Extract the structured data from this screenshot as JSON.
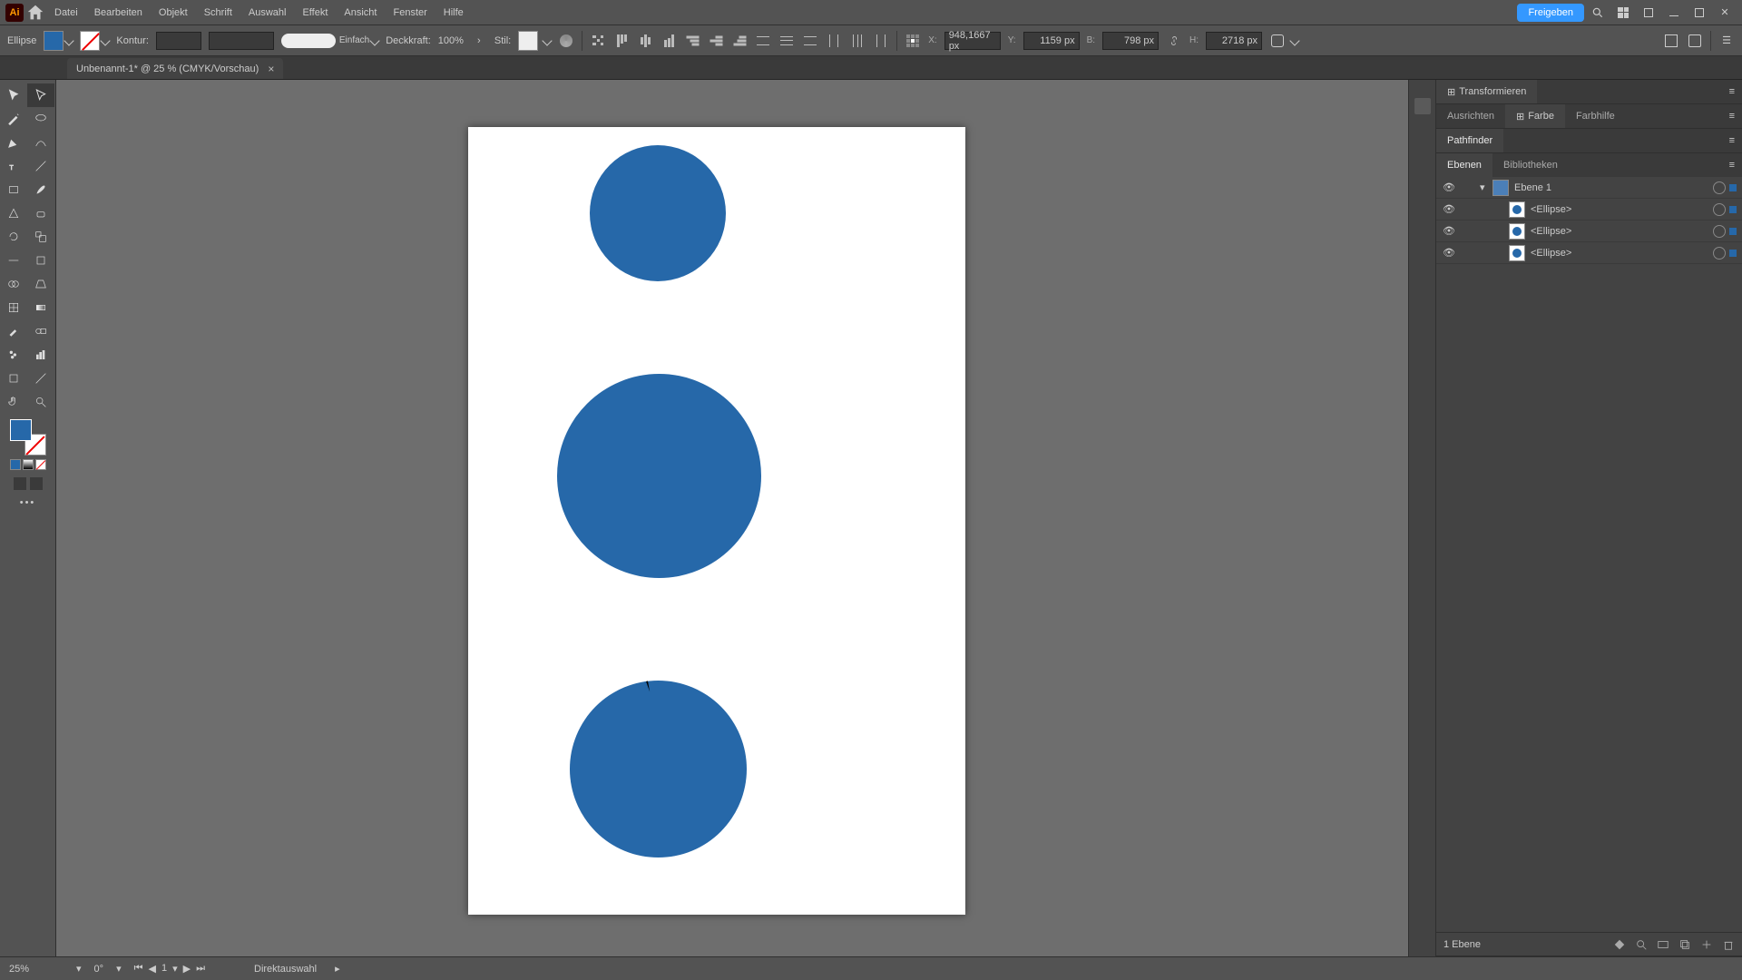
{
  "menu": {
    "items": [
      "Datei",
      "Bearbeiten",
      "Objekt",
      "Schrift",
      "Auswahl",
      "Effekt",
      "Ansicht",
      "Fenster",
      "Hilfe"
    ],
    "share": "Freigeben"
  },
  "optbar": {
    "shape": "Ellipse",
    "kontur": "Kontur:",
    "brush_label": "Einfach",
    "deckkraft_lbl": "Deckkraft:",
    "deckkraft_val": "100%",
    "stil_lbl": "Stil:",
    "x_lbl": "X:",
    "x_val": "948,1667 px",
    "y_lbl": "Y:",
    "y_val": "1159 px",
    "b_lbl": "B:",
    "b_val": "798 px",
    "h_lbl": "H:",
    "h_val": "2718 px"
  },
  "tab": {
    "title": "Unbenannt-1* @ 25 % (CMYK/Vorschau)",
    "close": "×"
  },
  "panels": {
    "transform": "Transformieren",
    "ausrichten": "Ausrichten",
    "farbe": "Farbe",
    "farbhilfe": "Farbhilfe",
    "pathfinder": "Pathfinder",
    "ebenen": "Ebenen",
    "biblio": "Bibliotheken"
  },
  "layers": {
    "top": "Ebene 1",
    "items": [
      "<Ellipse>",
      "<Ellipse>",
      "<Ellipse>"
    ],
    "footer": "1 Ebene"
  },
  "status": {
    "zoom": "25%",
    "rot": "0°",
    "page": "1",
    "tool": "Direktauswahl"
  }
}
